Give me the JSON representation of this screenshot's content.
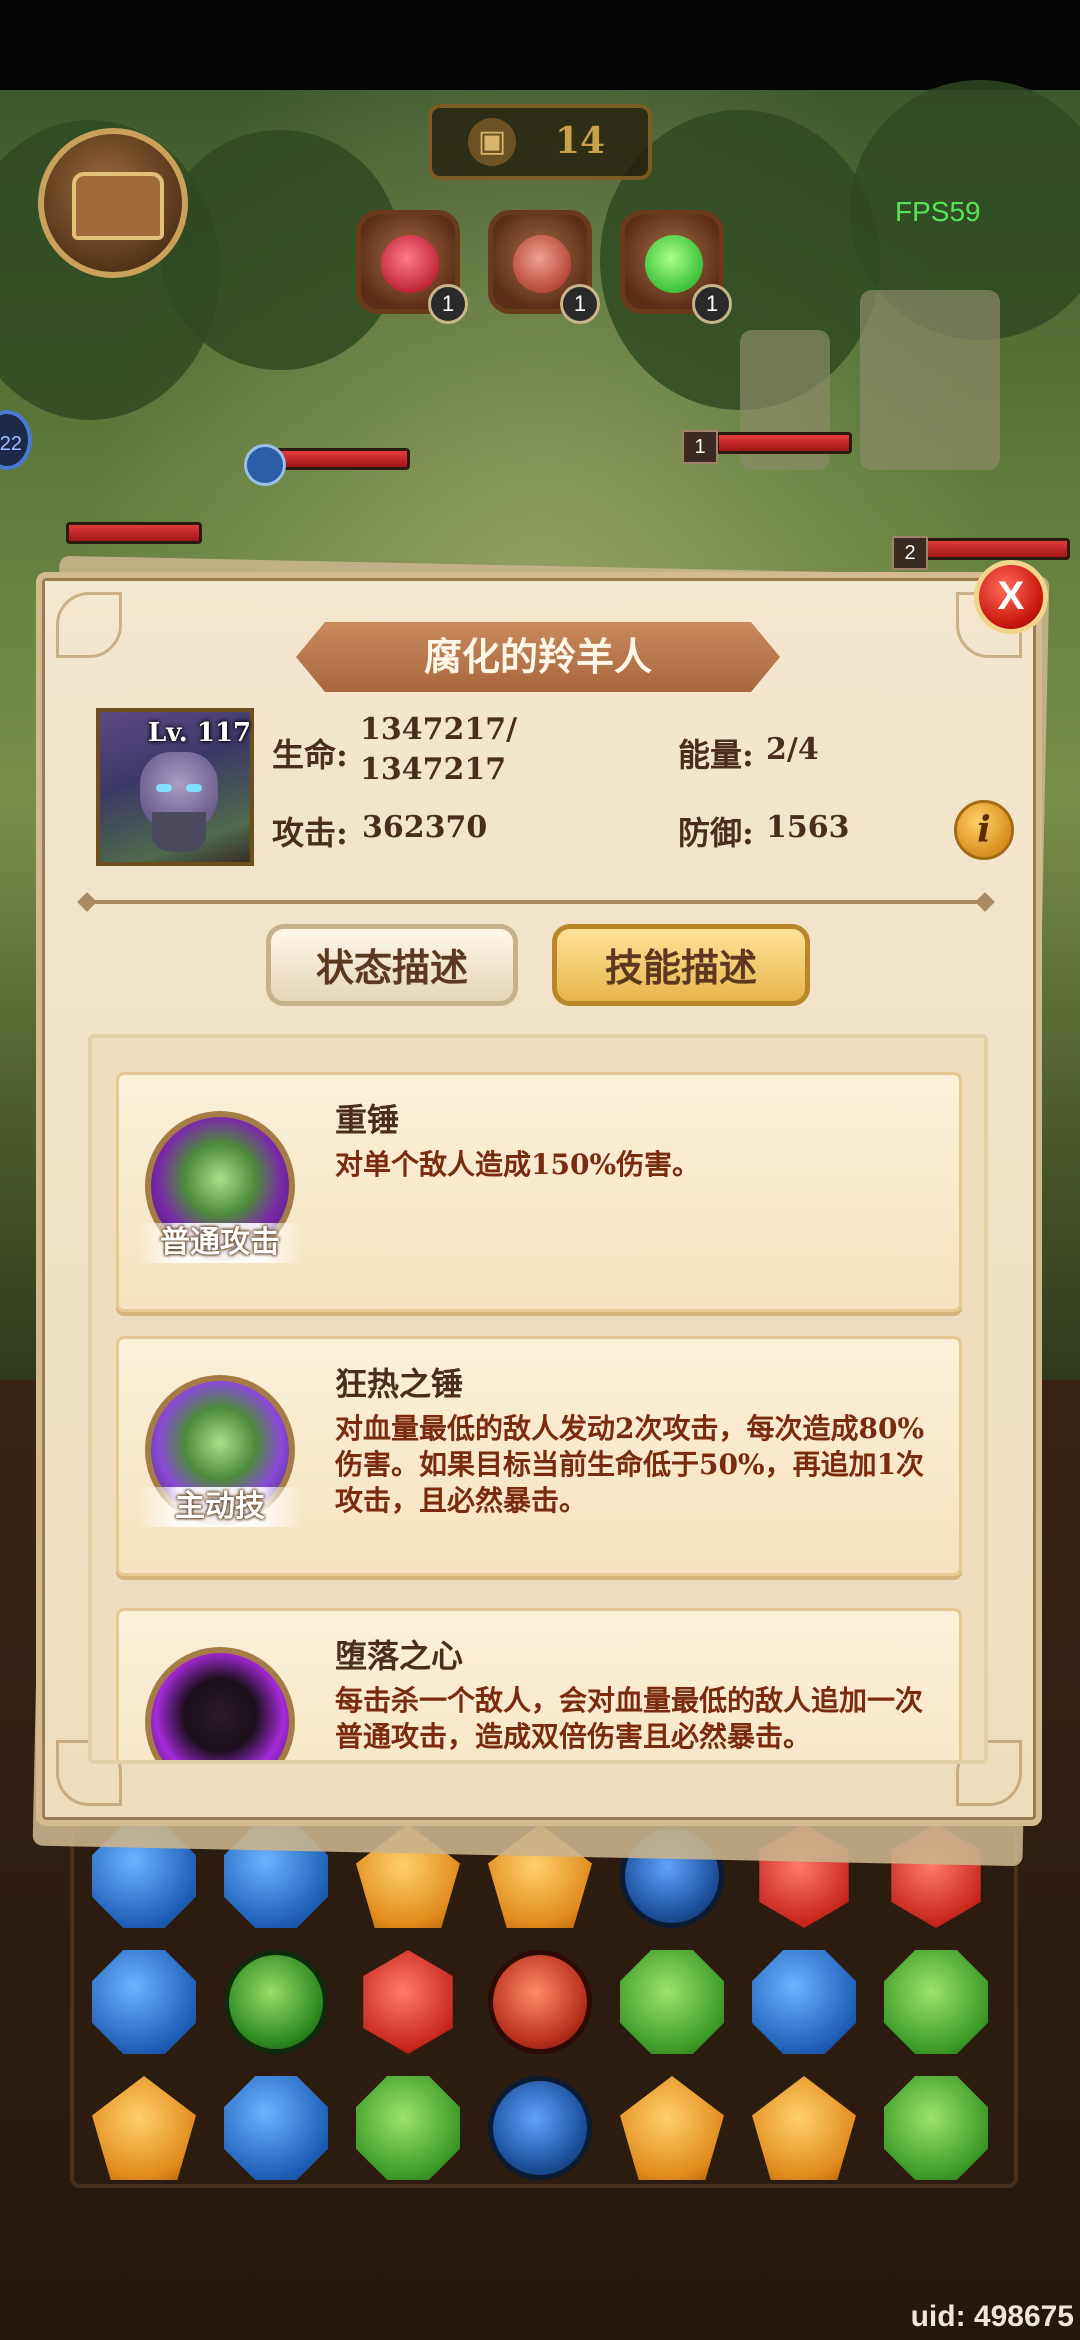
{
  "hud": {
    "gift_count": "14",
    "fps": "FPS59",
    "items": [
      {
        "icon": "red-gem-pouch-icon",
        "count": "1",
        "color": "#c0283a"
      },
      {
        "icon": "meat-icon",
        "count": "1",
        "color": "#b74a3a"
      },
      {
        "icon": "green-potion-icon",
        "count": "1",
        "color": "#3ec23a"
      }
    ],
    "partial_left_badge": "22",
    "enemy_levels": [
      "1",
      "2"
    ]
  },
  "dialog": {
    "title": "腐化的羚羊人",
    "portrait_level": "Lv. 117",
    "stats": {
      "hp_label": "生命:",
      "hp_value_line1": "1347217/",
      "hp_value_line2": "1347217",
      "energy_label": "能量:",
      "energy_value": "2/4",
      "attack_label": "攻击:",
      "attack_value": "362370",
      "defense_label": "防御:",
      "defense_value": "1563"
    },
    "info_label": "i",
    "tabs": {
      "status": "状态描述",
      "skills": "技能描述",
      "active": "skills"
    },
    "skills": [
      {
        "name": "重锤",
        "type": "普通攻击",
        "description": "对单个敌人造成150%伤害。"
      },
      {
        "name": "狂热之锤",
        "type": "主动技",
        "description": "对血量最低的敌人发动2次攻击，每次造成80%伤害。如果目标当前生命低于50%，再追加1次攻击，且必然暴击。"
      },
      {
        "name": "堕落之心",
        "type": "",
        "description": "每击杀一个敌人，会对血量最低的敌人追加一次普通攻击，造成双倍伤害且必然暴击。"
      }
    ],
    "close_label": "X"
  },
  "board": {
    "rows": [
      [
        "blue",
        "blue",
        "orange",
        "orange",
        "star-blue",
        "red",
        "red"
      ],
      [
        "blue",
        "star-green",
        "red",
        "star-red",
        "green",
        "blue",
        "green"
      ],
      [
        "orange",
        "blue",
        "green",
        "star-blue",
        "orange",
        "orange",
        "green"
      ]
    ]
  },
  "footer": {
    "uid": "uid: 498675"
  }
}
